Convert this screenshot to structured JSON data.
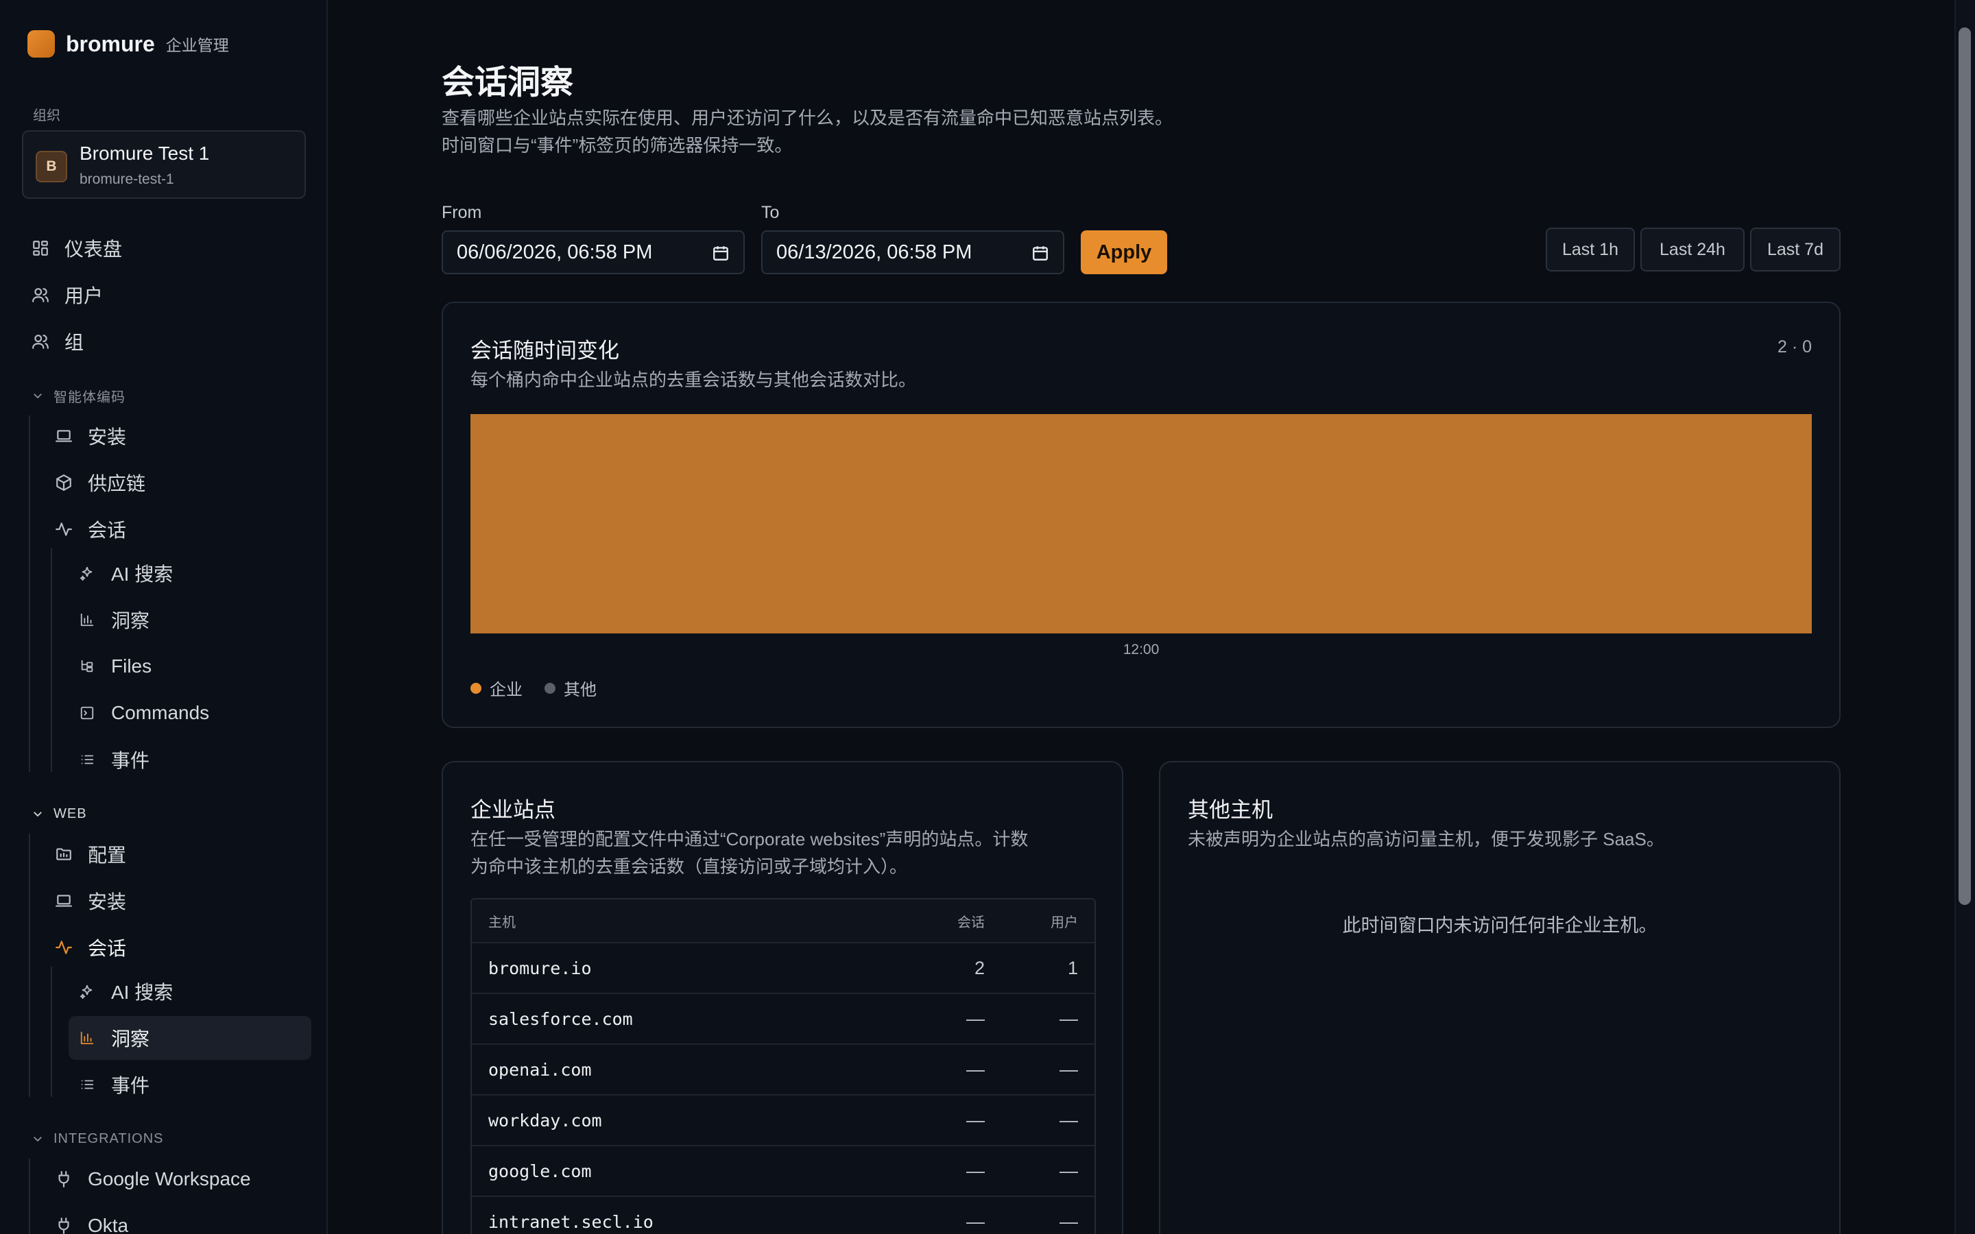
{
  "brand": {
    "name": "bromure",
    "subtitle": "企业管理"
  },
  "org": {
    "label": "组织",
    "avatar_letter": "B",
    "name": "Bromure Test 1",
    "slug": "bromure-test-1"
  },
  "nav": {
    "dashboard": "仪表盘",
    "users": "用户",
    "groups": "组",
    "agent_section": "智能体编码",
    "agent_install": "安装",
    "agent_supply_chain": "供应链",
    "agent_sessions": "会话",
    "agent_ai_search": "AI 搜索",
    "agent_insights": "洞察",
    "agent_files": "Files",
    "agent_commands": "Commands",
    "agent_events": "事件",
    "web_section": "WEB",
    "web_config": "配置",
    "web_install": "安装",
    "web_sessions": "会话",
    "web_ai_search": "AI 搜索",
    "web_insights": "洞察",
    "web_events": "事件",
    "integrations_section": "INTEGRATIONS",
    "google_workspace": "Google Workspace",
    "okta": "Okta"
  },
  "page": {
    "title": "会话洞察",
    "desc_line1": "查看哪些企业站点实际在使用、用户还访问了什么，以及是否有流量命中已知恶意站点列表。",
    "desc_line2": "时间窗口与“事件”标签页的筛选器保持一致。"
  },
  "filters": {
    "from_label": "From",
    "from_value": "06/06/2026, 06:58 PM",
    "to_label": "To",
    "to_value": "06/13/2026, 06:58 PM",
    "apply_label": "Apply",
    "last_1h": "Last 1h",
    "last_24h": "Last 24h",
    "last_7d": "Last 7d"
  },
  "colors": {
    "accent": "#e88d2d",
    "corporate_bar": "#bd742d",
    "other_dot": "#5b606a"
  },
  "sessions_chart": {
    "title": "会话随时间变化",
    "desc": "每个桶内命中企业站点的去重会话数与其他会话数对比。",
    "count": "2 · 0",
    "legend_corporate": "企业",
    "legend_other": "其他"
  },
  "chart_data": {
    "type": "bar",
    "categories": [
      "12:00"
    ],
    "series": [
      {
        "name": "企业",
        "values": [
          2
        ]
      },
      {
        "name": "其他",
        "values": [
          0
        ]
      }
    ],
    "stacked": true,
    "xlabel": "",
    "ylabel": "",
    "grid": false,
    "legend": "bottom-left"
  },
  "corporate_sites": {
    "title": "企业站点",
    "desc_line1": "在任一受管理的配置文件中通过“Corporate websites”声明的站点。计数",
    "desc_line2": "为命中该主机的去重会话数（直接访问或子域均计入）。",
    "headers": {
      "host": "主机",
      "sessions": "会话",
      "users": "用户"
    },
    "rows": [
      {
        "host": "bromure.io",
        "sessions": "2",
        "users": "1"
      },
      {
        "host": "salesforce.com",
        "sessions": "—",
        "users": "—"
      },
      {
        "host": "openai.com",
        "sessions": "—",
        "users": "—"
      },
      {
        "host": "workday.com",
        "sessions": "—",
        "users": "—"
      },
      {
        "host": "google.com",
        "sessions": "—",
        "users": "—"
      },
      {
        "host": "intranet.secl.io",
        "sessions": "—",
        "users": "—"
      }
    ]
  },
  "other_hosts": {
    "title": "其他主机",
    "desc": "未被声明为企业站点的高访问量主机，便于发现影子 SaaS。",
    "empty": "此时间窗口内未访问任何非企业主机。"
  }
}
